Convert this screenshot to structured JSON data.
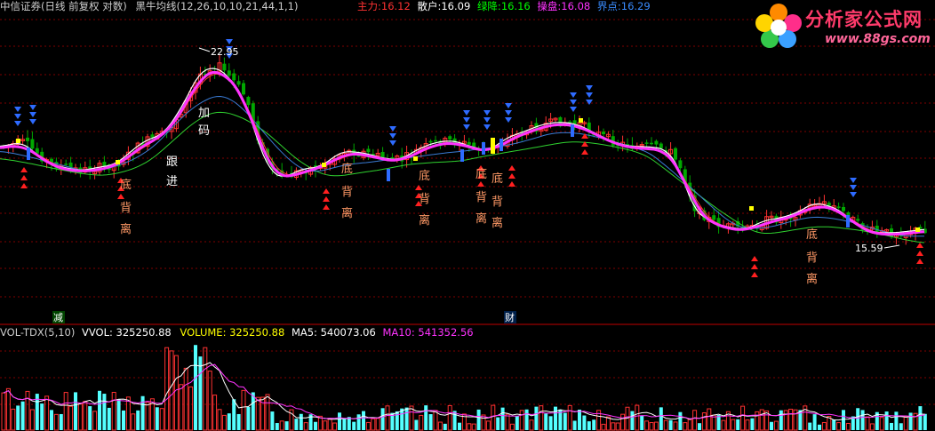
{
  "colors": {
    "background": "#000000",
    "grid": "#800000",
    "up": "#ff3232",
    "down": "#54ffff",
    "main_down": "#00a800",
    "ma_magenta": "#ff33ff",
    "ma_white": "#ffffff",
    "ma_blue": "#3a7bd5",
    "ma_green": "#2fd12f",
    "ma_red": "#ff3a3a",
    "arrow_down": "#2e6bff",
    "arrow_up": "#ff2020",
    "label_orange": "#ff9966",
    "label_white": "#ffffff",
    "marker_yellow": "#ffff00",
    "marker_blue": "#2e6bff"
  },
  "header": {
    "broker": "中信证券(日线 前复权 对数)",
    "indicator_name": "黑牛均线(12,26,10,10,21,44,1,1)",
    "items": [
      {
        "label": "主力:",
        "value": "16.12",
        "color": "#ff3232"
      },
      {
        "label": "散户:",
        "value": "16.09",
        "color": "#ffffff"
      },
      {
        "label": "绿降:",
        "value": "16.16",
        "color": "#00ff00"
      },
      {
        "label": "操盘:",
        "value": "16.08",
        "color": "#ff33ff"
      },
      {
        "label": "界点:",
        "value": "16.29",
        "color": "#3a8cff"
      }
    ]
  },
  "watermark": {
    "title": "分析家公式网",
    "url": "www.88gs.com"
  },
  "annotations": {
    "price_high": "22.95",
    "price_low": "15.59",
    "jia": "加",
    "ma": "码",
    "gen": "跟",
    "jin": "进",
    "di": "底",
    "bei": "背",
    "li": "离",
    "jian": "减",
    "cai": "财"
  },
  "volume_panel": {
    "name": "VOL-TDX(5,10)",
    "vvol_label": "VVOL:",
    "vvol_value": "325250.88",
    "volume_label": "VOLUME:",
    "volume_value": "325250.88",
    "ma5_label": "MA5:",
    "ma5_value": "540073.06",
    "ma10_label": "MA10:",
    "ma10_value": "541352.56"
  }
}
